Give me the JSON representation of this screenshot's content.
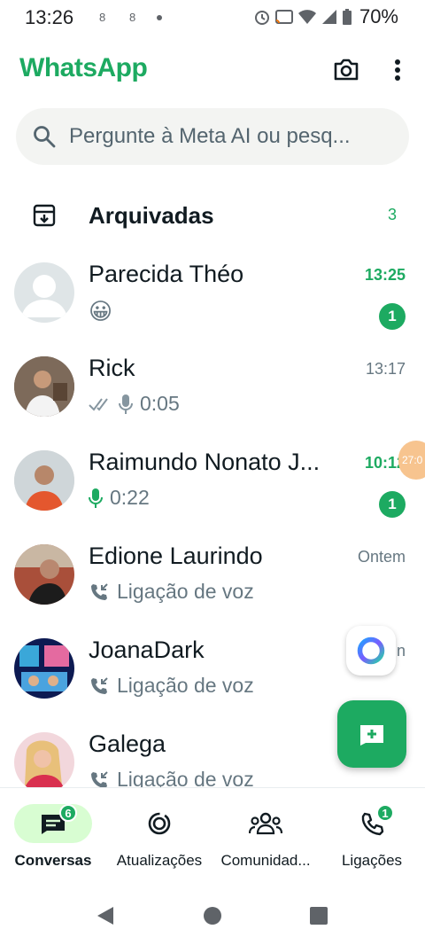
{
  "status_bar": {
    "time": "13:26",
    "notif_icons": [
      "8",
      "8"
    ],
    "battery": "70%"
  },
  "app": {
    "title": "WhatsApp"
  },
  "search": {
    "placeholder": "Pergunte à Meta AI ou pesq..."
  },
  "archived": {
    "label": "Arquivadas",
    "count": "3"
  },
  "chats": [
    {
      "name": "Parecida Théo",
      "time": "13:25",
      "preview": "😀",
      "unread": "1"
    },
    {
      "name": "Rick",
      "time": "13:17",
      "preview": "0:05"
    },
    {
      "name": "Raimundo Nonato J...",
      "time": "10:12",
      "preview": "0:22",
      "unread": "1"
    },
    {
      "name": "Edione Laurindo",
      "time": "Ontem",
      "preview": "Ligação de voz"
    },
    {
      "name": "JoanaDark",
      "time": "n",
      "preview": "Ligação de voz"
    },
    {
      "name": "Galega",
      "preview": "Ligação de voz"
    }
  ],
  "overlay": {
    "bubble_text": "27:0"
  },
  "nav": [
    {
      "label": "Conversas",
      "badge": "6"
    },
    {
      "label": "Atualizações"
    },
    {
      "label": "Comunidad..."
    },
    {
      "label": "Ligações",
      "badge": "1"
    }
  ],
  "colors": {
    "brand_green": "#1daa61",
    "active_pill": "#d8fdd2",
    "text_secondary": "#667781"
  }
}
